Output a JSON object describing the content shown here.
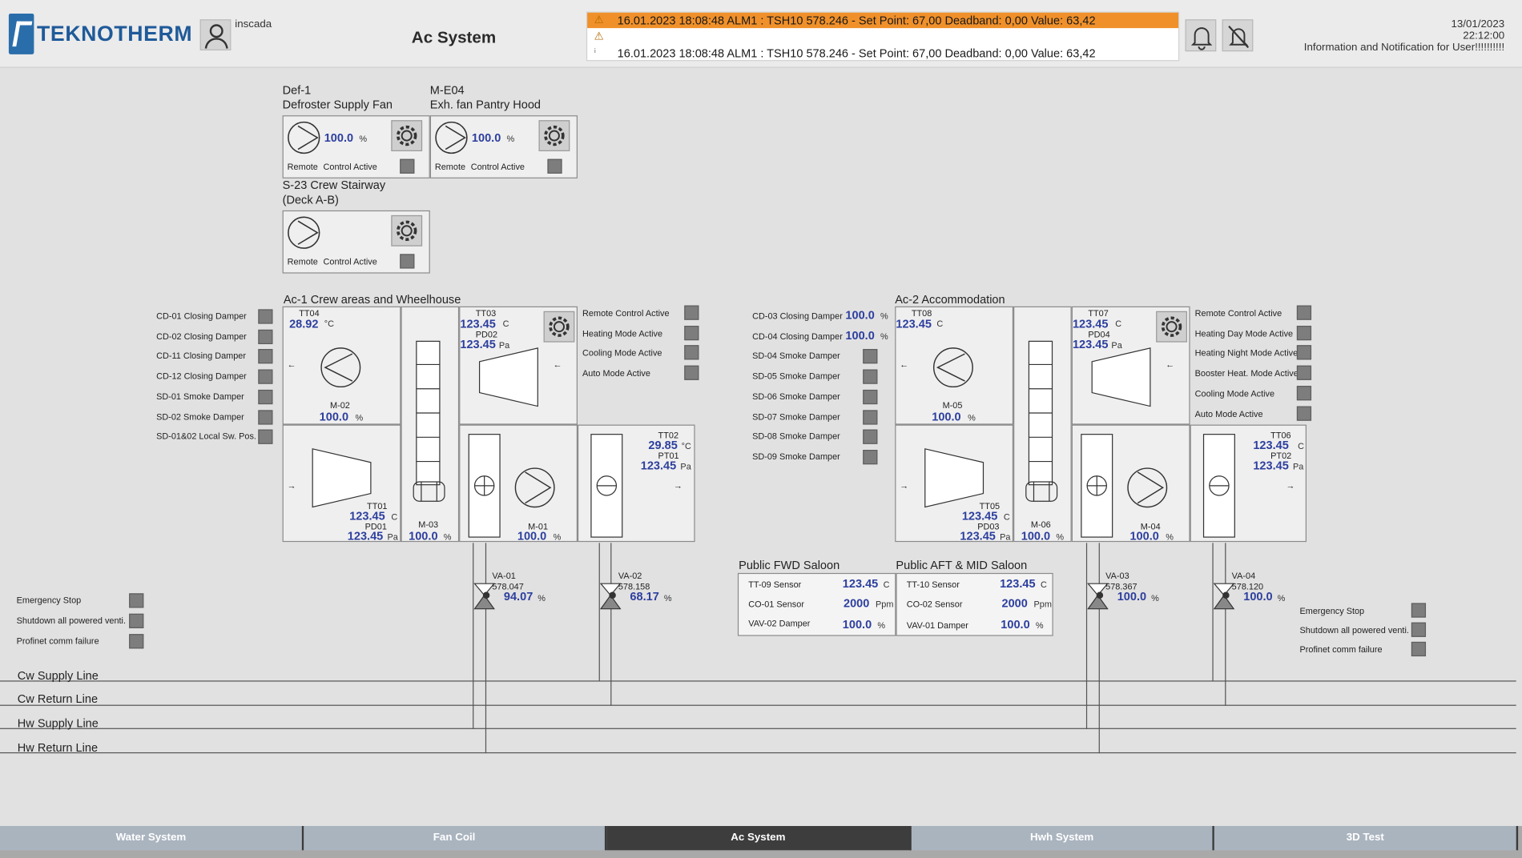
{
  "header": {
    "logo_text": "TEKNOTHERM",
    "username": "inscada",
    "page_title": "Ac System",
    "alarms": [
      {
        "icon": "warning-icon",
        "text": "16.01.2023 18:08:48 ALM1 : TSH10 578.246 - Set Point: 67,00  Deadband: 0,00  Value: 63,42",
        "color": "#f0902a"
      },
      {
        "icon": "warning-icon",
        "text": ""
      },
      {
        "icon": "info-icon",
        "text": "16.01.2023 18:08:48 ALM1 : TSH10 578.246 - Set Point: 67,00  Deadband: 0,00  Value: 63,42"
      }
    ],
    "date": "13/01/2023",
    "time": "22:12:00",
    "notification": "Information and Notification for User!!!!!!!!!!"
  },
  "fans": [
    {
      "code": "Def-1",
      "name": "Defroster Supply Fan",
      "value": "100.0",
      "unit": "%",
      "remote": "Remote",
      "control": "Control Active"
    },
    {
      "code": "M-E04",
      "name": "Exh. fan Pantry Hood",
      "value": "100.0",
      "unit": "%",
      "remote": "Remote",
      "control": "Control Active"
    },
    {
      "code": "S-23 Crew Stairway",
      "name": "(Deck A-B)",
      "remote": "Remote",
      "control": "Control Active"
    }
  ],
  "ac1": {
    "title": "Ac-1 Crew areas and Wheelhouse",
    "left_labels": [
      "CD-01 Closing Damper",
      "CD-02 Closing Damper",
      "CD-11 Closing Damper",
      "CD-12 Closing Damper",
      "SD-01 Smoke Damper",
      "SD-02 Smoke Damper",
      "SD-01&02 Local Sw. Pos."
    ],
    "right_labels": [
      "Remote Control Active",
      "Heating Mode Active",
      "Cooling Mode Active",
      "Auto Mode Active"
    ],
    "tt04": {
      "tag": "TT04",
      "value": "28.92",
      "unit": "°C"
    },
    "m02": {
      "tag": "M-02",
      "value": "100.0",
      "unit": "%"
    },
    "tt03": {
      "tag": "TT03",
      "value": "123.45",
      "unit": "C"
    },
    "pd02": {
      "tag": "PD02",
      "value": "123.45",
      "unit": "Pa"
    },
    "tt01": {
      "tag": "TT01",
      "value": "123.45",
      "unit": "C"
    },
    "pd01": {
      "tag": "PD01",
      "value": "123.45",
      "unit": "Pa"
    },
    "m03": {
      "tag": "M-03",
      "value": "100.0",
      "unit": "%"
    },
    "m01": {
      "tag": "M-01",
      "value": "100.0",
      "unit": "%"
    },
    "tt02": {
      "tag": "TT02",
      "value": "29.85",
      "unit": "°C"
    },
    "pt01": {
      "tag": "PT01",
      "value": "123.45",
      "unit": "Pa"
    },
    "va01": {
      "tag": "VA-01",
      "sub": "578.047",
      "value": "94.07",
      "unit": "%"
    },
    "va02": {
      "tag": "VA-02",
      "sub": "578.158",
      "value": "68.17",
      "unit": "%"
    }
  },
  "ac2": {
    "title": "Ac-2 Accommodation",
    "left_labels": [
      {
        "text": "CD-03 Closing Damper",
        "value": "100.0",
        "unit": "%"
      },
      {
        "text": "CD-04 Closing Damper",
        "value": "100.0",
        "unit": "%"
      },
      {
        "text": "SD-04 Smoke Damper"
      },
      {
        "text": "SD-05 Smoke Damper"
      },
      {
        "text": "SD-06 Smoke Damper"
      },
      {
        "text": "SD-07 Smoke Damper"
      },
      {
        "text": "SD-08 Smoke Damper"
      },
      {
        "text": "SD-09 Smoke Damper"
      }
    ],
    "right_labels": [
      "Remote Control Active",
      "Heating Day Mode Active",
      "Heating Night Mode Active",
      "Booster Heat. Mode Active",
      "Cooling Mode Active",
      "Auto Mode Active"
    ],
    "tt08": {
      "tag": "TT08",
      "value": "123.45",
      "unit": "C"
    },
    "m05": {
      "tag": "M-05",
      "value": "100.0",
      "unit": "%"
    },
    "tt07": {
      "tag": "TT07",
      "value": "123.45",
      "unit": "C"
    },
    "pd04": {
      "tag": "PD04",
      "value": "123.45",
      "unit": "Pa"
    },
    "tt05": {
      "tag": "TT05",
      "value": "123.45",
      "unit": "C"
    },
    "pd03": {
      "tag": "PD03",
      "value": "123.45",
      "unit": "Pa"
    },
    "m06": {
      "tag": "M-06",
      "value": "100.0",
      "unit": "%"
    },
    "m04": {
      "tag": "M-04",
      "value": "100.0",
      "unit": "%"
    },
    "tt06": {
      "tag": "TT06",
      "value": "123.45",
      "unit": "C"
    },
    "pt02": {
      "tag": "PT02",
      "value": "123.45",
      "unit": "Pa"
    },
    "va03": {
      "tag": "VA-03",
      "sub": "578.367",
      "value": "100.0",
      "unit": "%"
    },
    "va04": {
      "tag": "VA-04",
      "sub": "578.120",
      "value": "100.0",
      "unit": "%"
    }
  },
  "saloons": [
    {
      "title": "Public FWD Saloon",
      "rows": [
        {
          "label": "TT-09 Sensor",
          "value": "123.45",
          "unit": "C"
        },
        {
          "label": "CO-01 Sensor",
          "value": "2000",
          "unit": "Ppm"
        },
        {
          "label": "VAV-02 Damper",
          "value": "100.0",
          "unit": "%"
        }
      ]
    },
    {
      "title": "Public AFT & MID Saloon",
      "rows": [
        {
          "label": "TT-10 Sensor",
          "value": "123.45",
          "unit": "C"
        },
        {
          "label": "CO-02 Sensor",
          "value": "2000",
          "unit": "Ppm"
        },
        {
          "label": "VAV-01 Damper",
          "value": "100.0",
          "unit": "%"
        }
      ]
    }
  ],
  "emergency_left": [
    "Emergency Stop",
    "Shutdown all powered venti.",
    "Profinet comm failure"
  ],
  "emergency_right": [
    "Emergency Stop",
    "Shutdown all powered venti.",
    "Profinet comm failure"
  ],
  "pipes": [
    "Cw Supply Line",
    "Cw Return Line",
    "Hw Supply Line",
    "Hw Return Line"
  ],
  "nav": [
    {
      "label": "Water System",
      "active": false
    },
    {
      "label": "Fan Coil",
      "active": false
    },
    {
      "label": "Ac System",
      "active": true
    },
    {
      "label": "Hwh System",
      "active": false
    },
    {
      "label": "3D Test",
      "active": false
    }
  ],
  "colors": {
    "value": "#2d3f9e",
    "alarm": "#f0902a",
    "status_off": "#7d7d7d",
    "nav": "#aab4bf",
    "nav_active": "#3d3d3d"
  }
}
